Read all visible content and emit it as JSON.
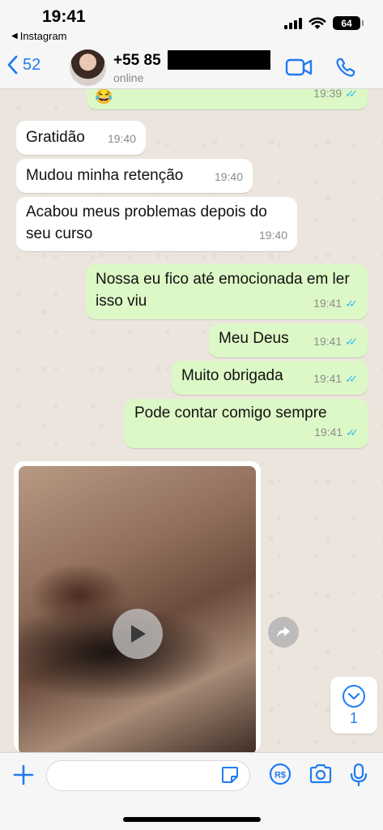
{
  "status_bar": {
    "time": "19:41",
    "back_app": "Instagram",
    "battery": "64"
  },
  "header": {
    "back_count": "52",
    "contact_name": "+55 85",
    "contact_status": "online"
  },
  "messages": [
    {
      "direction": "out",
      "text": "",
      "time": "19:39",
      "ticks": "✓✓"
    },
    {
      "direction": "in",
      "text": "Gratidão",
      "time": "19:40"
    },
    {
      "direction": "in",
      "text": "Mudou minha retenção",
      "time": "19:40"
    },
    {
      "direction": "in",
      "text": "Acabou meus problemas depois do seu curso",
      "time": "19:40"
    },
    {
      "direction": "out",
      "text": "Nossa eu fico até emocionada em ler isso viu",
      "time": "19:41",
      "ticks": "✓✓"
    },
    {
      "direction": "out",
      "text": "Meu Deus",
      "time": "19:41",
      "ticks": "✓✓"
    },
    {
      "direction": "out",
      "text": "Muito obrigada",
      "time": "19:41",
      "ticks": "✓✓"
    },
    {
      "direction": "out",
      "text": "Pode contar comigo sempre",
      "time": "19:41",
      "ticks": "✓✓"
    }
  ],
  "scroll_down": {
    "unread": "1"
  },
  "input": {
    "placeholder": ""
  },
  "colors": {
    "accent": "#1f7cf0",
    "outgoing_bubble": "#dcf8c6",
    "incoming_bubble": "#ffffff",
    "read_ticks": "#34b7f1"
  },
  "icons": [
    "video-call-icon",
    "phone-icon",
    "play-icon",
    "forward-icon",
    "chevron-down-icon",
    "plus-icon",
    "sticker-icon",
    "payment-icon",
    "camera-icon",
    "microphone-icon"
  ]
}
